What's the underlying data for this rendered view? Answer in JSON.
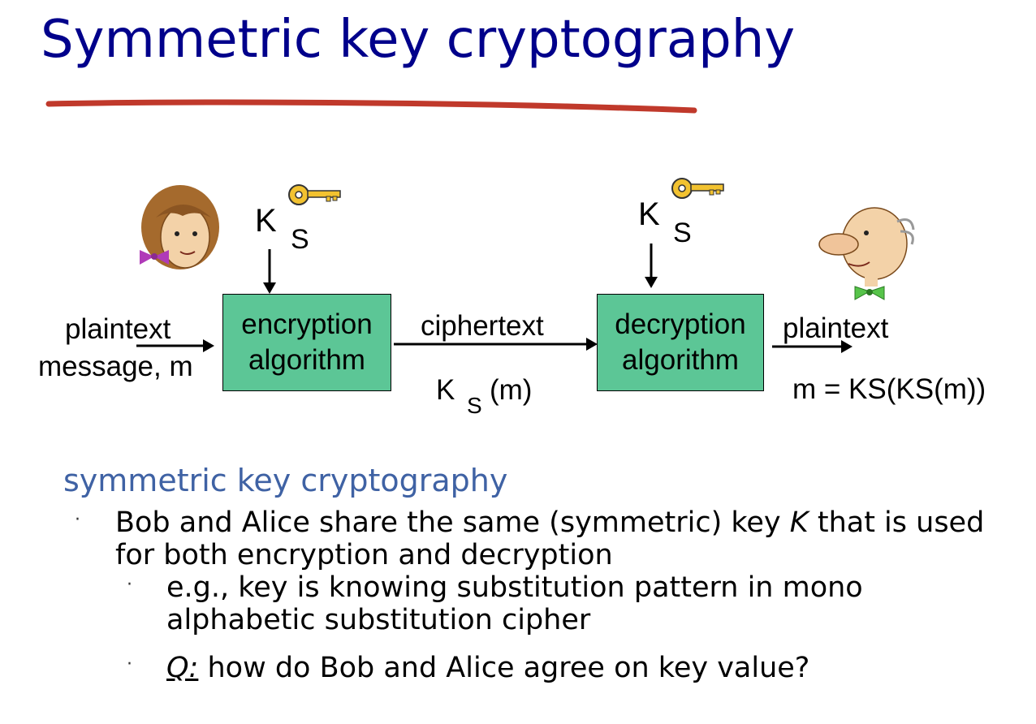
{
  "title": "Symmetric key cryptography",
  "colors": {
    "title": "#00008b",
    "underline": "#c0392b",
    "box_fill": "#5cc696",
    "heading": "#3f62a4",
    "key_gold": "#f2c230"
  },
  "diagram": {
    "left_key": {
      "main": "K",
      "sub": "S"
    },
    "right_key": {
      "main": "K",
      "sub": "S"
    },
    "encrypt_box": {
      "line1": "encryption",
      "line2": "algorithm"
    },
    "decrypt_box": {
      "line1": "decryption",
      "line2": "algorithm"
    },
    "plaintext_in_label1": "plaintext",
    "plaintext_in_label2": "message, m",
    "ciphertext_label": "ciphertext",
    "ciphertext_value": {
      "main": "K",
      "sub": "S",
      "rest": "(m)"
    },
    "plaintext_out_label": "plaintext",
    "plaintext_out_value": "m = KS(KS(m))",
    "icons": [
      "alice-icon",
      "bob-icon",
      "key-icon"
    ]
  },
  "section": {
    "heading": "symmetric key cryptography",
    "bullet1_pre": "Bob and Alice share the same (symmetric) key ",
    "bullet1_k": "K",
    "bullet1_post": " that is used for both encryption and decryption",
    "sub1": "e.g., key is knowing substitution pattern in mono alphabetic substitution cipher",
    "sub2_q": "Q:",
    "sub2_rest": " how do Bob and Alice agree on key value?"
  }
}
